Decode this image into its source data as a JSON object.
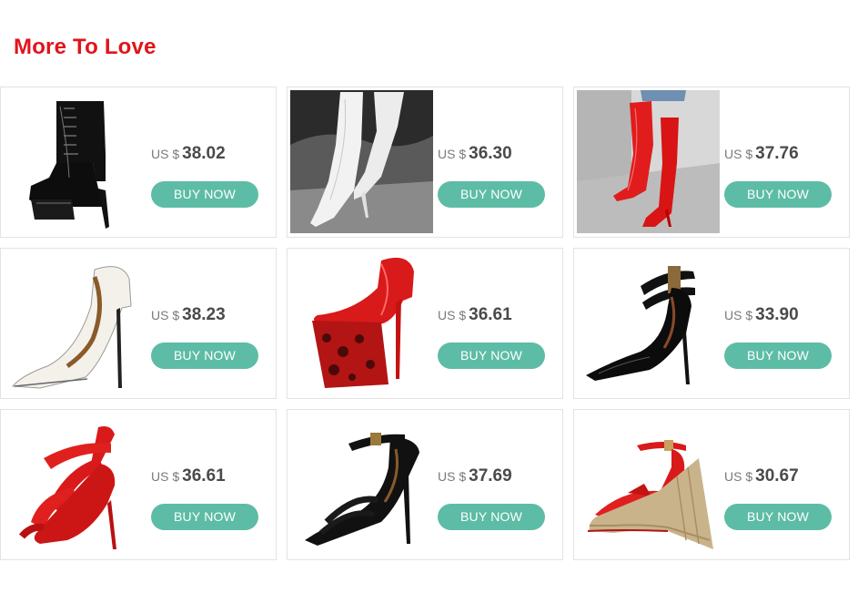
{
  "section": {
    "title": "More To Love"
  },
  "colors": {
    "title": "#e0141c",
    "button_bg": "#5dbca5",
    "button_text": "#ffffff",
    "card_border": "#e3e3e3"
  },
  "buy_label": "BUY NOW",
  "currency_label": "US $",
  "products": [
    {
      "icon": "black-platform-ankle-boot-icon",
      "price": "38.02"
    },
    {
      "icon": "white-thigh-high-boot-icon",
      "price": "36.30"
    },
    {
      "icon": "red-thigh-high-boot-icon",
      "price": "37.76"
    },
    {
      "icon": "white-stiletto-pump-icon",
      "price": "38.23"
    },
    {
      "icon": "red-leopard-platform-pump-icon",
      "price": "36.61"
    },
    {
      "icon": "black-ankle-strap-pump-icon",
      "price": "33.90"
    },
    {
      "icon": "red-strappy-heel-sandal-icon",
      "price": "36.61"
    },
    {
      "icon": "black-strappy-heel-sandal-icon",
      "price": "37.69"
    },
    {
      "icon": "red-espadrille-wedge-sandal-icon",
      "price": "30.67"
    }
  ]
}
